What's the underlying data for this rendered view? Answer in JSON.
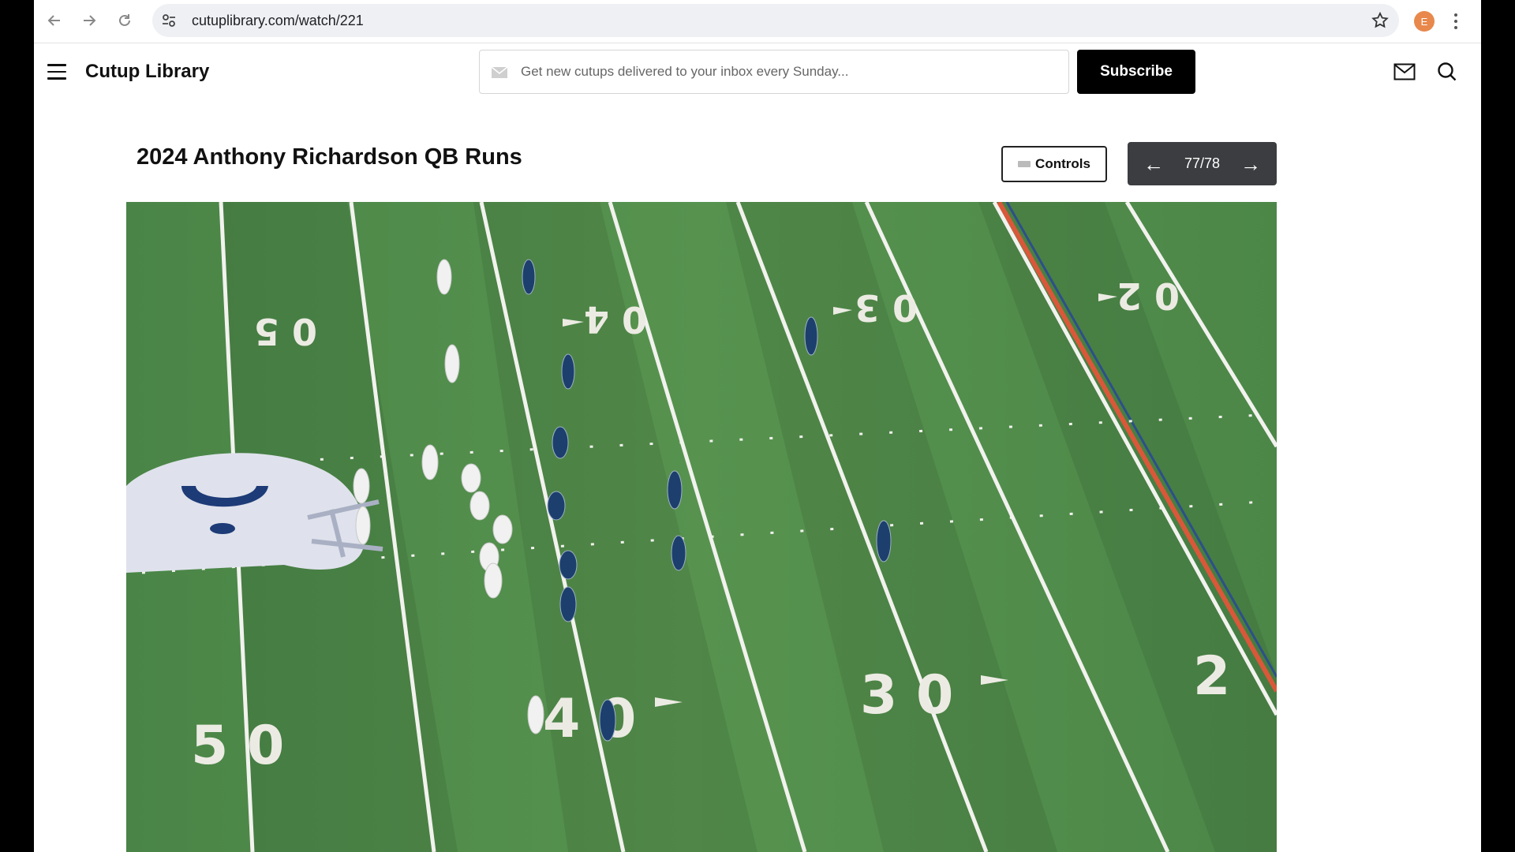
{
  "browser": {
    "url": "cutuplibrary.com/watch/221",
    "profile_initial": "E",
    "back_icon": "arrow-left-icon",
    "forward_icon": "arrow-right-icon",
    "reload_icon": "reload-icon",
    "bookmark_icon": "star-icon"
  },
  "header": {
    "brand": "Cutup Library",
    "subscribe_placeholder": "Get new cutups delivered to your inbox every Sunday...",
    "subscribe_label": "Subscribe"
  },
  "page": {
    "title": "2024 Anthony Richardson QB Runs",
    "controls_label": "Controls",
    "pager": {
      "prev": "←",
      "count": "77/78",
      "next": "→"
    }
  },
  "video": {
    "yard_numbers": {
      "far": [
        "0 5",
        "0 4",
        "0 3",
        "0 2"
      ],
      "near": [
        "5 0",
        "4 0",
        "3 0",
        "2"
      ]
    },
    "colors": {
      "field": "#4f8a4b",
      "home_team": "#1c3f6e",
      "away_team": "#f0f0f0"
    }
  }
}
